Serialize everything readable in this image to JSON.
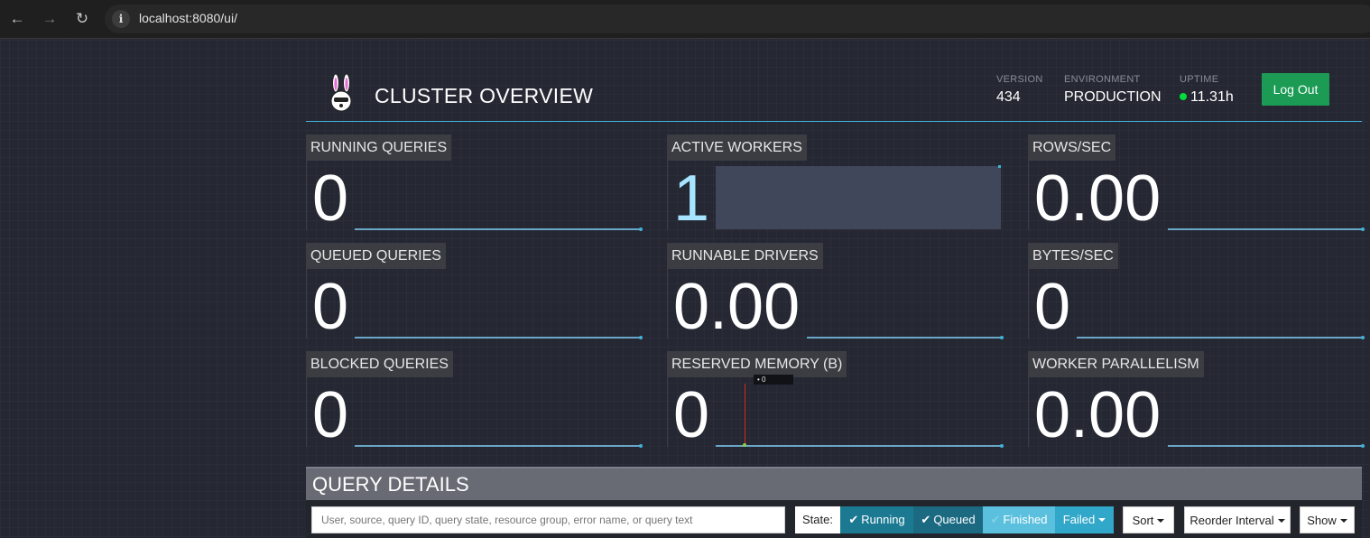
{
  "browser": {
    "url": "localhost:8080/ui/",
    "back_icon": "←",
    "forward_icon": "→",
    "reload_icon": "↻",
    "info_icon": "i"
  },
  "header": {
    "title": "CLUSTER OVERVIEW",
    "version_label": "VERSION",
    "version_value": "434",
    "environment_label": "ENVIRONMENT",
    "environment_value": "PRODUCTION",
    "uptime_label": "UPTIME",
    "uptime_value": "11.31h",
    "logout_label": "Log Out"
  },
  "tiles": {
    "running_queries": {
      "label": "RUNNING QUERIES",
      "value": "0"
    },
    "active_workers": {
      "label": "ACTIVE WORKERS",
      "value": "1"
    },
    "rows_sec": {
      "label": "ROWS/SEC",
      "value": "0.00"
    },
    "queued_queries": {
      "label": "QUEUED QUERIES",
      "value": "0"
    },
    "runnable_drivers": {
      "label": "RUNNABLE DRIVERS",
      "value": "0.00"
    },
    "bytes_sec": {
      "label": "BYTES/SEC",
      "value": "0"
    },
    "blocked_queries": {
      "label": "BLOCKED QUERIES",
      "value": "0"
    },
    "reserved_memory": {
      "label": "RESERVED MEMORY (B)",
      "value": "0",
      "tooltip": "• 0"
    },
    "worker_parallelism": {
      "label": "WORKER PARALLELISM",
      "value": "0.00"
    }
  },
  "query_details": {
    "title": "QUERY DETAILS",
    "search_placeholder": "User, source, query ID, query state, resource group, error name, or query text",
    "state_label": "State:",
    "filters": {
      "running": "Running",
      "queued": "Queued",
      "finished": "Finished",
      "failed": "Failed"
    },
    "check_icon": "✔",
    "sort_label": "Sort",
    "reorder_label": "Reorder Interval",
    "show_label": "Show"
  },
  "colors": {
    "accent": "#3fb3d8",
    "logout": "#1c9b54",
    "running": "#1b7a92",
    "queued": "#1b6a82",
    "finished": "#5bc0de",
    "failed": "#31a7c9"
  }
}
